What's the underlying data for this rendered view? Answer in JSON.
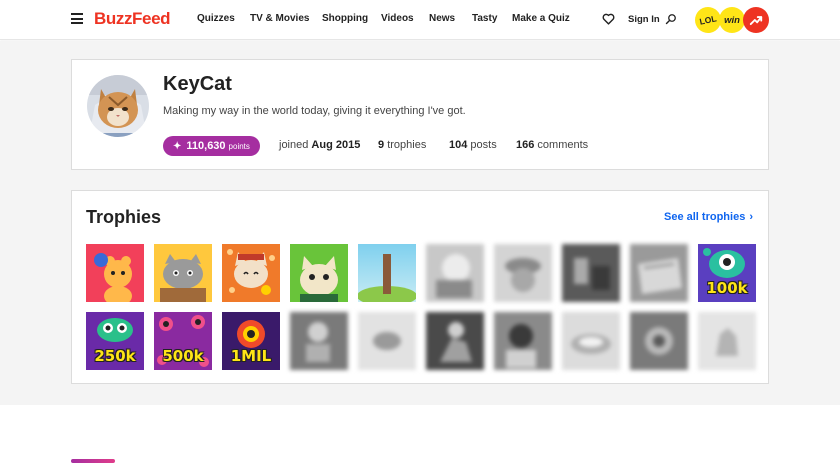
{
  "header": {
    "logo": "BuzzFeed",
    "nav": [
      "Quizzes",
      "TV & Movies",
      "Shopping",
      "Videos",
      "News",
      "Tasty",
      "Make a Quiz"
    ],
    "sign_in": "Sign In",
    "badges": {
      "lol": "LOL",
      "win": "win",
      "trending": "trending-icon"
    }
  },
  "profile": {
    "username": "KeyCat",
    "bio": "Making my way in the world today, giving it everything I've got.",
    "points_value": "110,630",
    "points_unit": "points",
    "joined_prefix": "joined",
    "joined_date": "Aug 2015",
    "trophies_count": "9",
    "trophies_label": "trophies",
    "posts_count": "104",
    "posts_label": "posts",
    "comments_count": "166",
    "comments_label": "comments"
  },
  "trophies": {
    "title": "Trophies",
    "see_all": "See all trophies",
    "milestones": [
      "100k",
      "250k",
      "500k",
      "1MIL"
    ]
  },
  "colors": {
    "brand_red": "#ee3322",
    "accent_purple": "#a52ea0",
    "link_blue": "#0f65ef",
    "badge_yellow": "#ffe517"
  }
}
